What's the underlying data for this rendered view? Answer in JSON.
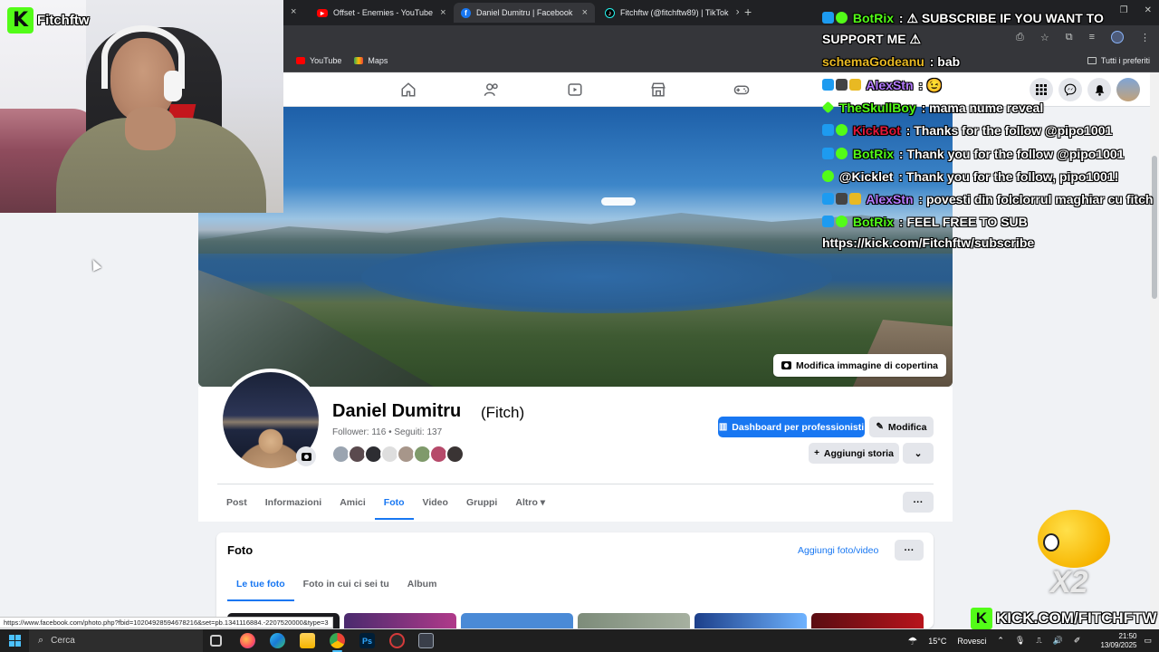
{
  "browser": {
    "tabs": [
      {
        "title": "Offset - Enemies - YouTube",
        "favicon": "youtube-icon",
        "color": "#ff0000",
        "active": false
      },
      {
        "title": "Daniel Dumitru | Facebook",
        "favicon": "facebook-icon",
        "color": "#1877f2",
        "active": true
      },
      {
        "title": "Fitchftw (@fitchftw89) | TikTok",
        "favicon": "tiktok-icon",
        "color": "#000000",
        "active": false
      }
    ],
    "close_glyph": "×",
    "new_tab_glyph": "+",
    "bookmarks": [
      {
        "label": "YouTube",
        "icon": "youtube-icon",
        "color": "#ff0000"
      },
      {
        "label": "Maps",
        "icon": "maps-icon",
        "color": "#34a853"
      }
    ],
    "all_bookmarks": "Tutti i preferiti"
  },
  "facebook": {
    "cover_button": "Modifica immagine di copertina",
    "profile": {
      "name": "Daniel Dumitru",
      "alternate_name": "(Fitch)",
      "stats": "Follower: 116 • Seguiti: 137"
    },
    "buttons": {
      "dashboard": "Dashboard per professionisti",
      "edit": "Modifica",
      "add_story": "Aggiungi storia"
    },
    "tabs": [
      {
        "label": "Post",
        "active": false
      },
      {
        "label": "Informazioni",
        "active": false
      },
      {
        "label": "Amici",
        "active": false
      },
      {
        "label": "Foto",
        "active": true
      },
      {
        "label": "Video",
        "active": false
      },
      {
        "label": "Gruppi",
        "active": false
      },
      {
        "label": "Altro ▾",
        "active": false
      }
    ],
    "photos": {
      "title": "Foto",
      "add_link": "Aggiungi foto/video",
      "tabs": [
        {
          "label": "Le tue foto",
          "active": true
        },
        {
          "label": "Foto in cui ci sei tu",
          "active": false
        },
        {
          "label": "Album",
          "active": false
        }
      ]
    },
    "status_url": "https://www.facebook.com/photo.php?fbid=10204928594678216&set=pb.1341116884.-2207520000&type=3",
    "accent_color": "#1877f2"
  },
  "stream": {
    "channel_name": "Fitchftw",
    "chat": [
      {
        "user": "BotRix",
        "user_color": "#53fc18",
        "message": "⚠ SUBSCRIBE IF YOU WANT TO"
      },
      {
        "user": "",
        "user_color": "#ffffff",
        "message": "SUPPORT ME ⚠"
      },
      {
        "user": "schemaGodeanu",
        "user_color": "#e8b923",
        "message": "bab"
      },
      {
        "user": "AlexStn",
        "user_color": "#b57bff",
        "message": "😉"
      },
      {
        "user": "TheSkullBoy",
        "user_color": "#53fc18",
        "message": "mama nume reveal"
      },
      {
        "user": "KickBot",
        "user_color": "#e0183a",
        "message": "Thanks for the follow @pipo1001"
      },
      {
        "user": "BotRix",
        "user_color": "#53fc18",
        "message": "Thank you for the follow @pipo1001"
      },
      {
        "user": "@Kicklet",
        "user_color": "#ffffff",
        "message": "Thank you for the follow, pipo1001!"
      },
      {
        "user": "AlexStn",
        "user_color": "#b57bff",
        "message": "povesti din folclorrul maghiar cu fitch"
      },
      {
        "user": "BotRix",
        "user_color": "#53fc18",
        "message": "FEEL FREE TO SUB"
      },
      {
        "user": "",
        "user_color": "#ffffff",
        "message": "https://kick.com/Fitchftw/subscribe"
      }
    ],
    "emote_multiplier": "X2",
    "kick_url": "KICK.COM/FITCHFTW",
    "brand_color": "#53fc18"
  },
  "taskbar": {
    "search_placeholder": "Cerca",
    "weather": "15°C",
    "weather_desc": "Rovesci",
    "time": "21:50",
    "date": "13/09/2025"
  }
}
